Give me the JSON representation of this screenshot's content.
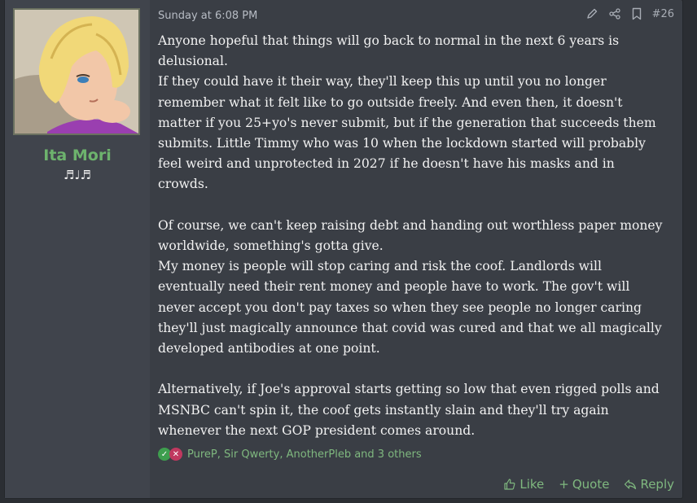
{
  "post": {
    "author": "Ita Mori",
    "user_title": "♬♩♬",
    "date": "Sunday at 6:08 PM",
    "post_number": "#26",
    "paragraphs": [
      [
        "Anyone hopeful that things will go back to normal in the next 6 years is",
        "delusional."
      ],
      [
        "If they could have it their way, they'll keep this up until you no longer",
        "remember what it felt like to go outside freely. And even then, it doesn't",
        "matter if you 25+yo's never submit, but if the generation that succeeds them",
        "submits. Little Timmy who was 10 when the lockdown started will probably",
        "feel weird and unprotected in 2027 if he doesn't have his masks and in",
        "crowds."
      ],
      [
        "Of course, we can't keep raising debt and handing out worthless paper money",
        "worldwide, something's gotta give."
      ],
      [
        "My money is people will stop caring and risk the coof. Landlords will",
        "eventually need their rent money and people have to work. The gov't will",
        "never accept you don't pay taxes so when they see people no longer caring",
        "they'll just magically announce that covid was cured and that we all magically",
        "developed antibodies at one point."
      ],
      [
        "Alternatively, if Joe's approval starts getting so low that even rigged polls and",
        "MSNBC can't spin it, the coof gets instantly slain and they'll try again",
        "whenever the next GOP president comes around."
      ]
    ],
    "reactions_text": "PureP, Sir Qwerty, AnotherPleb and 3 others",
    "actions": {
      "like": "Like",
      "quote": "Quote",
      "reply": "Reply"
    }
  },
  "icons": {
    "edit": "pencil-icon",
    "share": "share-icon",
    "bookmark": "bookmark-icon",
    "like": "thumbs-up-icon",
    "quote": "plus-icon",
    "reply": "reply-icon",
    "react_like": "check-icon",
    "react_dislike": "x-icon"
  },
  "colors": {
    "username": "#6db36d",
    "link": "#7fb87f",
    "react_like": "#3e9e4e",
    "react_dislike": "#c0385f"
  }
}
